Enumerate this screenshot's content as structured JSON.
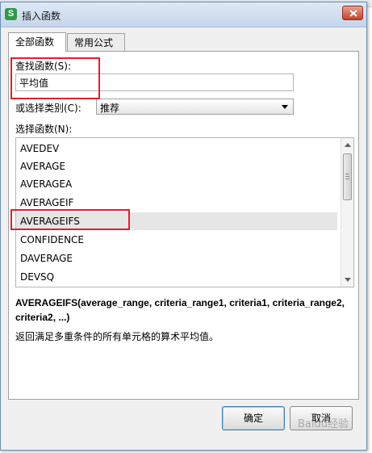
{
  "window": {
    "title": "插入函数",
    "app_icon_letter": "S"
  },
  "tabs": [
    {
      "label": "全部函数",
      "active": true
    },
    {
      "label": "常用公式",
      "active": false
    }
  ],
  "search": {
    "label": "查找函数(S):",
    "value": "平均值"
  },
  "category": {
    "label": "或选择类别(C):",
    "value": "推荐"
  },
  "function_list": {
    "label": "选择函数(N):",
    "items": [
      "AVEDEV",
      "AVERAGE",
      "AVERAGEA",
      "AVERAGEIF",
      "AVERAGEIFS",
      "CONFIDENCE",
      "DAVERAGE",
      "DEVSQ"
    ],
    "selected": "AVERAGEIFS"
  },
  "signature": "AVERAGEIFS(average_range, criteria_range1, criteria1, criteria_range2, criteria2, ...)",
  "description": "返回满足多重条件的所有单元格的算术平均值。",
  "buttons": {
    "ok": "确定",
    "cancel": "取消"
  },
  "highlight_color": "#e0202a",
  "watermark": "Baidu经验"
}
